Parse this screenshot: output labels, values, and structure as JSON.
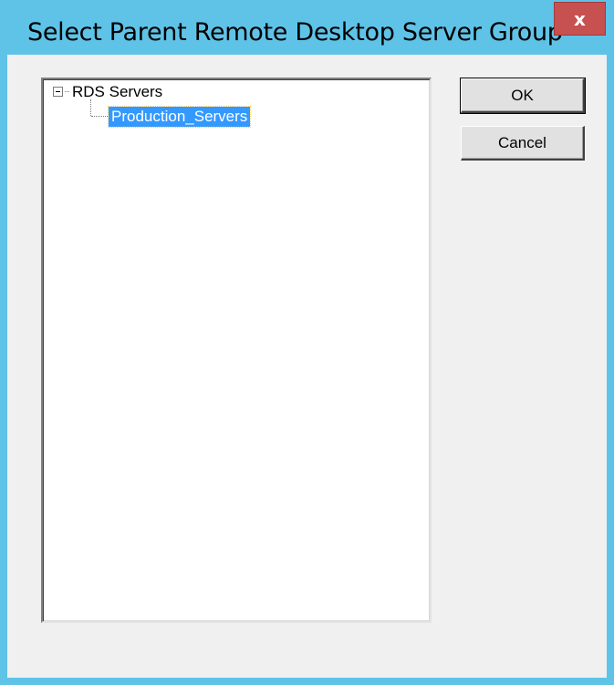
{
  "dialog": {
    "title": "Select Parent Remote Desktop Server Group",
    "close_glyph": "x"
  },
  "tree": {
    "root": {
      "label": "RDS Servers",
      "expanded": true,
      "icon": "collapse-icon"
    },
    "children": [
      {
        "label": "Production_Servers",
        "selected": true
      }
    ]
  },
  "buttons": {
    "ok_label": "OK",
    "cancel_label": "Cancel"
  },
  "colors": {
    "title_bar": "#5fc3e8",
    "close_button": "#c75050",
    "selection": "#3399ff",
    "client_bg": "#f0f0f0"
  }
}
